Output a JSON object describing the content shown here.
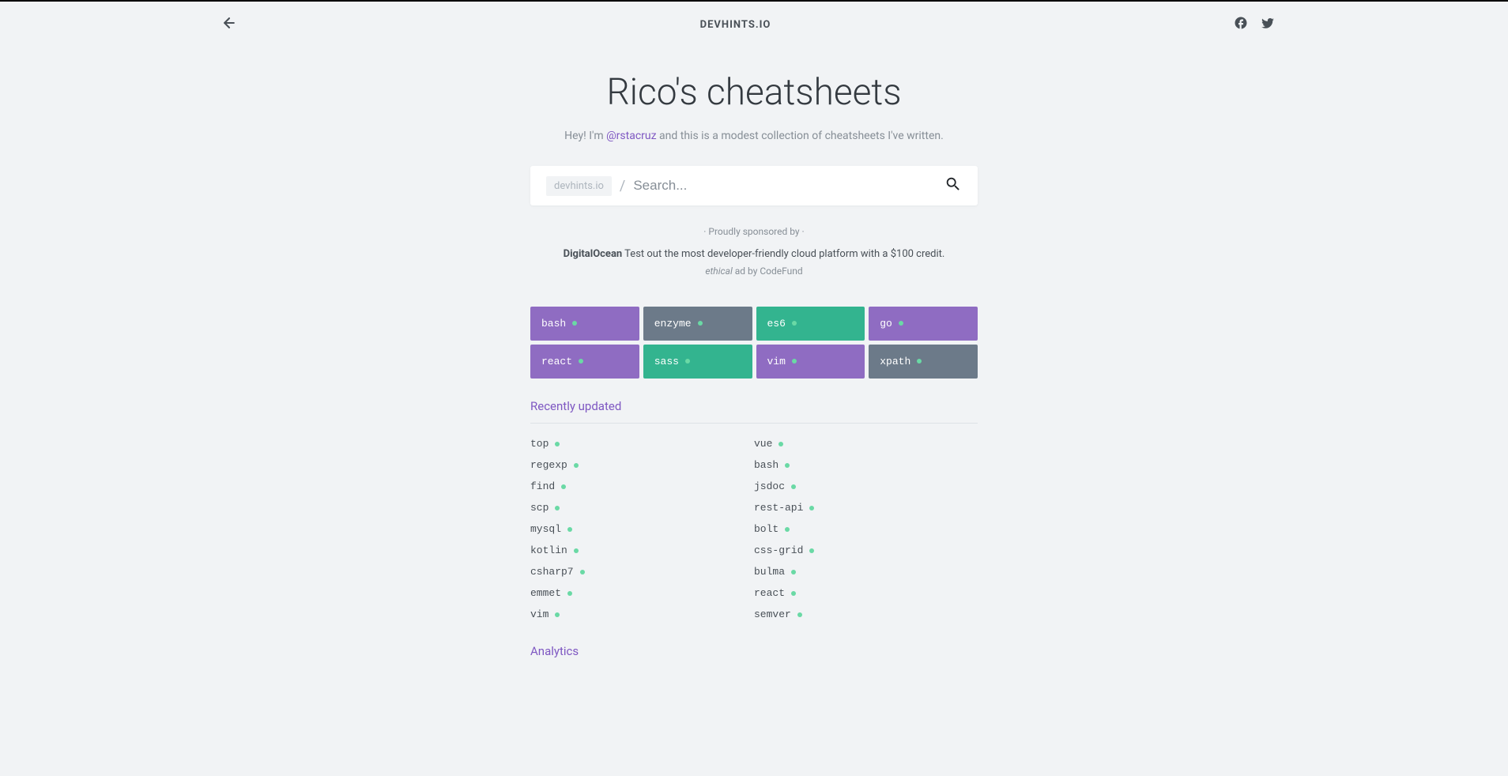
{
  "site": {
    "logo": "DEVHINTS.IO"
  },
  "hero": {
    "title": "Rico's cheatsheets",
    "intro_prefix": "Hey! I'm ",
    "intro_handle": "@rstacruz",
    "intro_suffix": " and this is a modest collection of cheatsheets I've written."
  },
  "search": {
    "prefix": "devhints.io",
    "slash": "/",
    "placeholder": "Search..."
  },
  "sponsor": {
    "line": "·  Proudly sponsored by  ·",
    "bold": "DigitalOcean",
    "text": " Test out the most developer-friendly cloud platform with a $100 credit.",
    "ethical_em": "ethical",
    "ethical_rest": " ad by CodeFund"
  },
  "featured": [
    {
      "label": "bash",
      "color": "purple"
    },
    {
      "label": "enzyme",
      "color": "slate"
    },
    {
      "label": "es6",
      "color": "teal"
    },
    {
      "label": "go",
      "color": "purple"
    },
    {
      "label": "react",
      "color": "purple"
    },
    {
      "label": "sass",
      "color": "teal"
    },
    {
      "label": "vim",
      "color": "purple"
    },
    {
      "label": "xpath",
      "color": "slate"
    }
  ],
  "sections": {
    "recently_updated": "Recently updated",
    "analytics": "Analytics"
  },
  "recent_left": [
    "top",
    "regexp",
    "find",
    "scp",
    "mysql",
    "kotlin",
    "csharp7",
    "emmet",
    "vim"
  ],
  "recent_right": [
    "vue",
    "bash",
    "jsdoc",
    "rest-api",
    "bolt",
    "css-grid",
    "bulma",
    "react",
    "semver"
  ]
}
